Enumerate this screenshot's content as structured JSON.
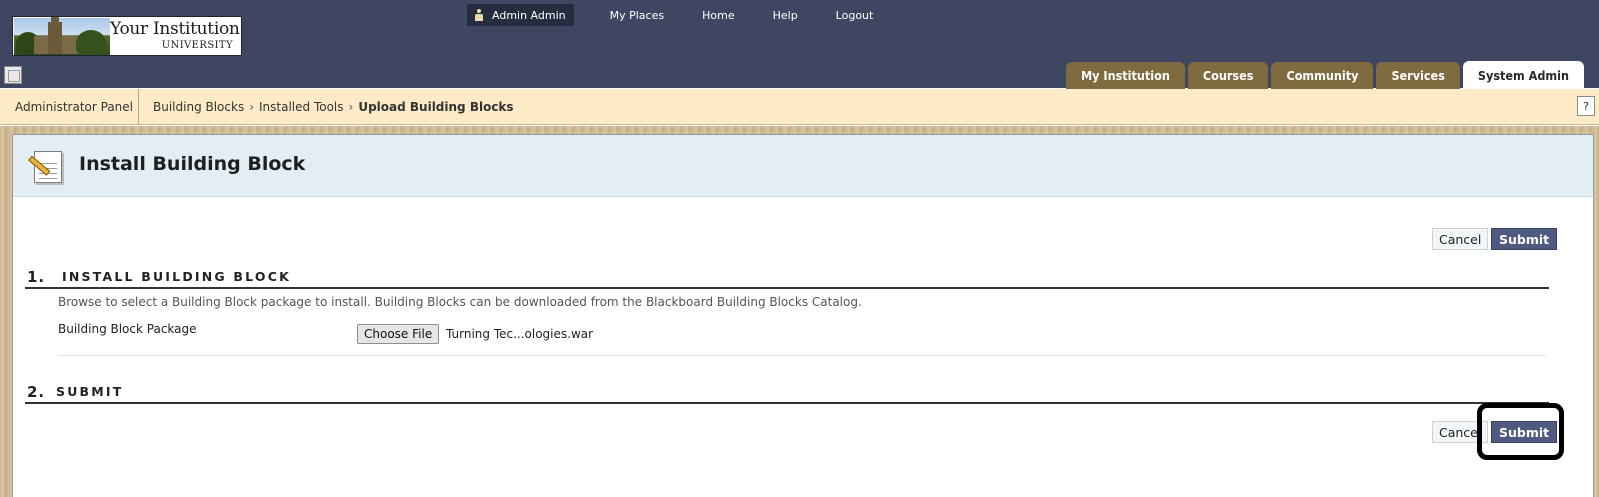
{
  "header": {
    "logo": {
      "line1": "Your Institution",
      "line2": "UNIVERSITY"
    },
    "user_link": "Admin Admin",
    "nav_links": [
      "My Places",
      "Home",
      "Help",
      "Logout"
    ],
    "tabs": [
      {
        "label": "My Institution",
        "active": false
      },
      {
        "label": "Courses",
        "active": false
      },
      {
        "label": "Community",
        "active": false
      },
      {
        "label": "Services",
        "active": false
      },
      {
        "label": "System Admin",
        "active": true
      }
    ]
  },
  "breadcrumb": {
    "admin_panel": "Administrator Panel",
    "items": [
      "Building Blocks",
      "Installed Tools",
      "Upload Building Blocks"
    ],
    "separator": "›",
    "help": "?"
  },
  "page": {
    "title": "Install Building Block",
    "buttons": {
      "cancel": "Cancel",
      "submit": "Submit"
    },
    "steps": [
      {
        "number": "1.",
        "title": "INSTALL BUILDING BLOCK",
        "instructions": "Browse to select a Building Block package to install. Building Blocks can be downloaded from the Blackboard Building Blocks Catalog.",
        "field_label": "Building Block Package",
        "file_button": "Choose File",
        "file_name": "Turning Tec...ologies.war"
      },
      {
        "number": "2.",
        "title": "SUBMIT"
      }
    ]
  },
  "colors": {
    "header_bg": "#3e4661",
    "tab_bg": "#806a40",
    "crumb_bg": "#fdebc8",
    "title_bar_bg": "#e2eef3",
    "submit_bg": "#4e5a80"
  }
}
